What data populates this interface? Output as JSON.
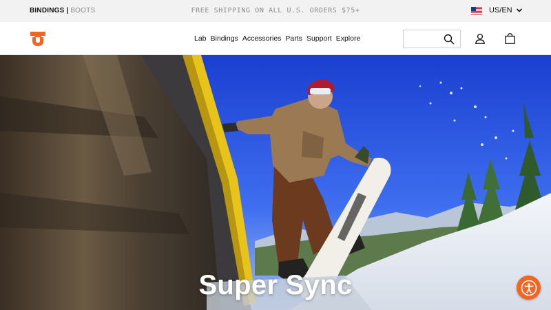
{
  "topbar": {
    "brand_active": "BINDINGS",
    "brand_separator": "|",
    "brand_inactive": "BOOTS",
    "promo": "FREE SHIPPING ON ALL U.S. ORDERS $75+",
    "locale": "US/EN",
    "flag_icon": "us-flag-icon"
  },
  "header": {
    "logo_icon": "union-logo-icon",
    "nav": [
      "Lab",
      "Bindings",
      "Accessories",
      "Parts",
      "Support",
      "Explore"
    ],
    "search": {
      "value": "",
      "placeholder": ""
    },
    "icons": [
      "search-icon",
      "user-icon",
      "shopping-bag-icon"
    ]
  },
  "hero": {
    "title": "Super Sync",
    "image": "snowboarder-rail-jibbing-photo"
  },
  "accessibility": {
    "icon": "accessibility-icon"
  },
  "colors": {
    "accent": "#f26522",
    "topbar_bg": "#f2f2f2",
    "text": "#111111",
    "muted": "#8a8a8a"
  }
}
